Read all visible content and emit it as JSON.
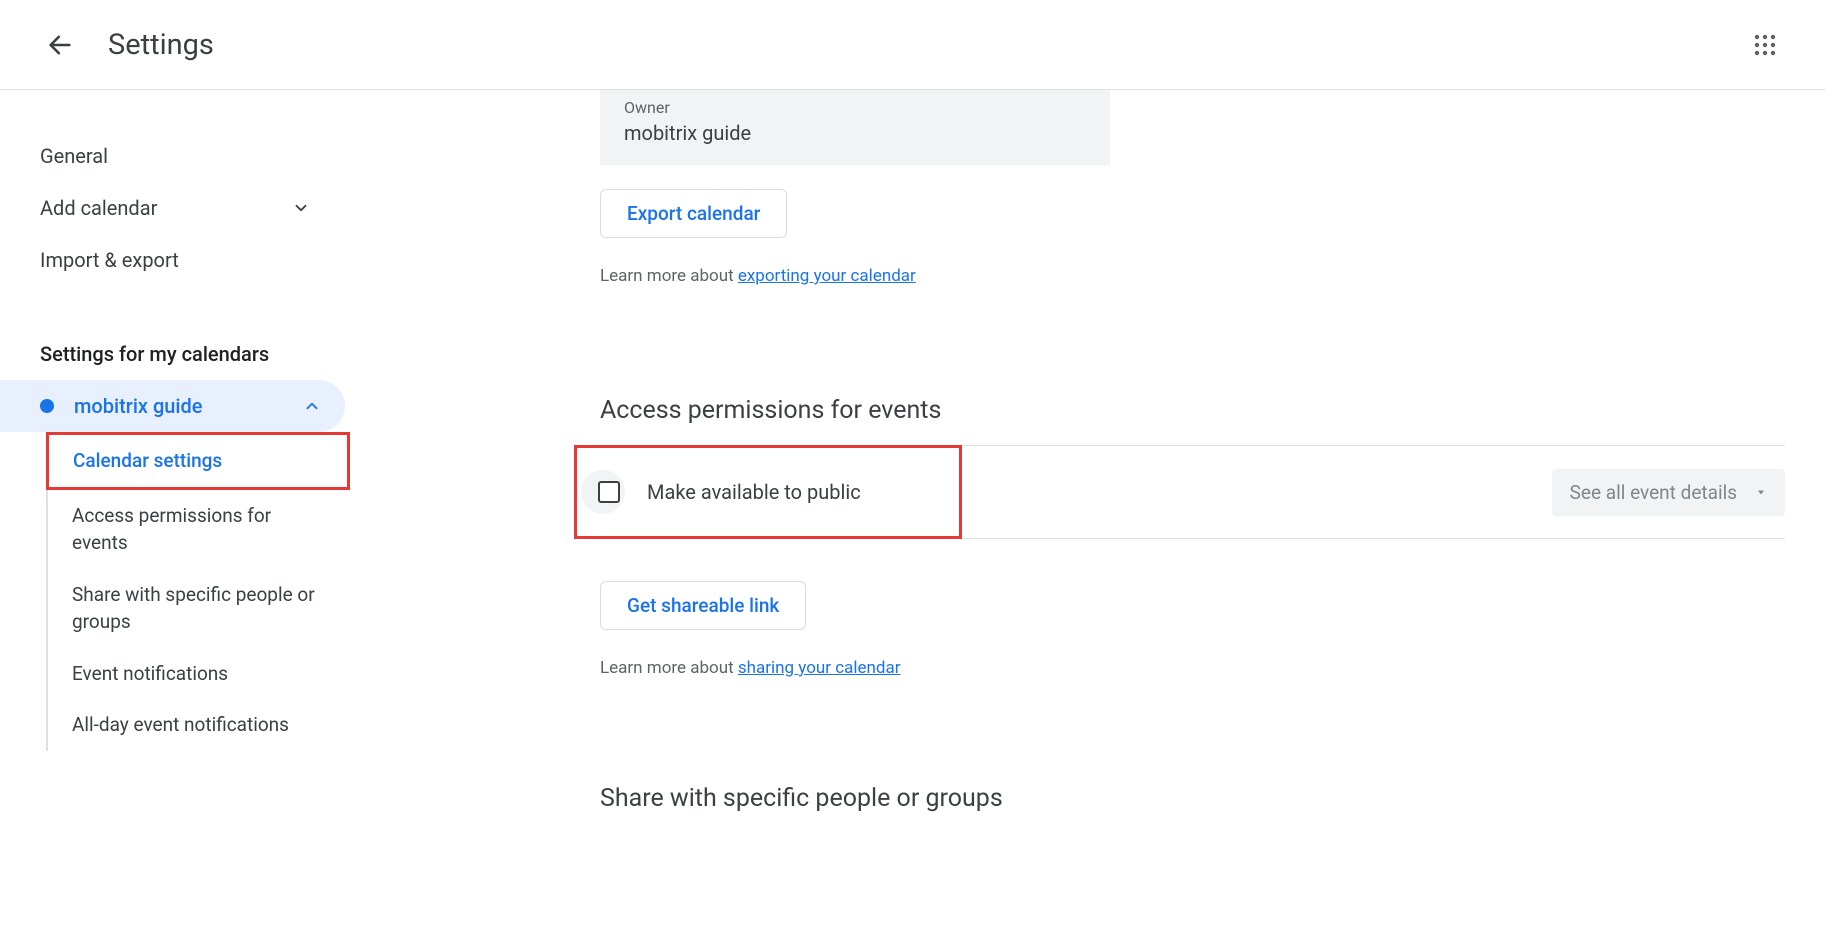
{
  "header": {
    "title": "Settings"
  },
  "sidebar": {
    "general": "General",
    "add_calendar": "Add calendar",
    "import_export": "Import & export",
    "section_title": "Settings for my calendars",
    "calendar_name": "mobitrix guide",
    "sub": {
      "calendar_settings": "Calendar settings",
      "access_permissions": "Access permissions for events",
      "share_specific": "Share with specific people or groups",
      "event_notifications": "Event notifications",
      "allday_notifications": "All-day event notifications"
    }
  },
  "main": {
    "owner_label": "Owner",
    "owner_value": "mobitrix guide",
    "export_btn": "Export calendar",
    "export_learn_prefix": "Learn more about ",
    "export_link": "exporting your calendar",
    "access_heading": "Access permissions for events",
    "make_public": "Make available to public",
    "see_details": "See all event details",
    "shareable_btn": "Get shareable link",
    "share_learn_prefix": "Learn more about ",
    "share_link": "sharing your calendar",
    "share_heading": "Share with specific people or groups"
  }
}
